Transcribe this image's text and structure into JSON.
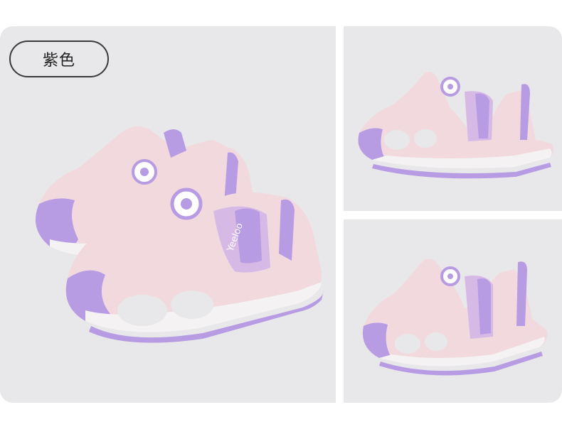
{
  "variant": {
    "color_label": "紫色"
  },
  "brand_text": "Yeeloo",
  "colors": {
    "lavender": "#b79be3",
    "lavender_dark": "#9a7bd4",
    "pink_mesh": "#f1d9de",
    "sole_white": "#f4f2f3",
    "panel_bg": "#e8e8ea"
  }
}
